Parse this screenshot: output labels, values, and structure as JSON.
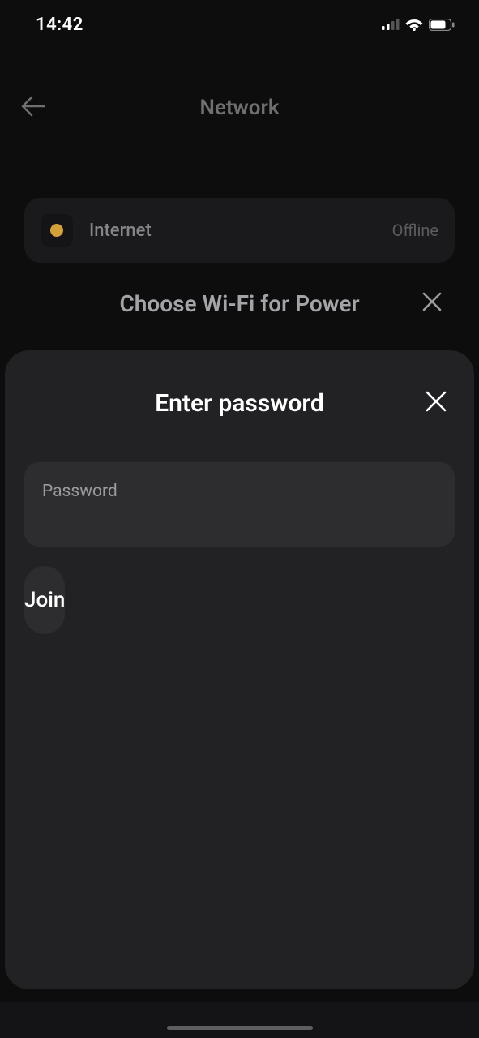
{
  "status_bar": {
    "time": "14:42"
  },
  "nav": {
    "title": "Network"
  },
  "internet": {
    "label": "Internet",
    "status": "Offline"
  },
  "choose": {
    "title": "Choose Wi-Fi for Power"
  },
  "modal": {
    "title": "Enter password",
    "password_label": "Password",
    "join_label": "Join"
  }
}
